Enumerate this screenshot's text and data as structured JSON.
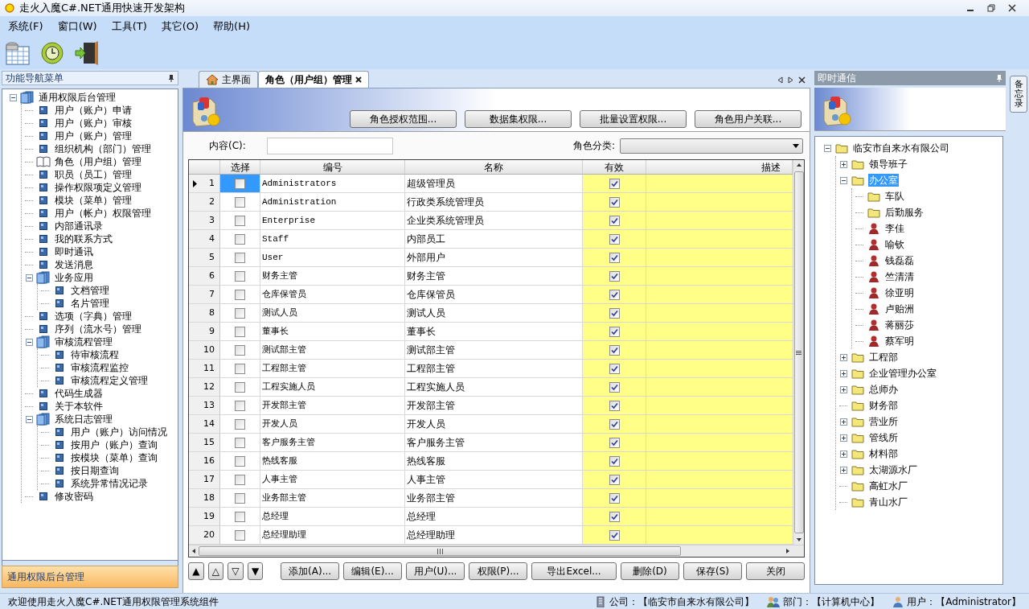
{
  "window": {
    "title": "走火入魔C#.NET通用快速开发架构"
  },
  "menu": [
    "系统(F)",
    "窗口(W)",
    "工具(T)",
    "其它(O)",
    "帮助(H)"
  ],
  "nav_panel": {
    "title": "功能导航菜单",
    "footer": "通用权限后台管理",
    "tree": [
      {
        "label": "通用权限后台管理",
        "kind": "group",
        "expanded": true,
        "children": [
          {
            "label": "用户（账户）申请",
            "kind": "item"
          },
          {
            "label": "用户（账户）审核",
            "kind": "item"
          },
          {
            "label": "用户（账户）管理",
            "kind": "item"
          },
          {
            "label": "组织机构（部门）管理",
            "kind": "item"
          },
          {
            "label": "角色（用户组）管理",
            "kind": "book"
          },
          {
            "label": "职员（员工）管理",
            "kind": "item"
          },
          {
            "label": "操作权限项定义管理",
            "kind": "item"
          },
          {
            "label": "模块（菜单）管理",
            "kind": "item"
          },
          {
            "label": "用户（帐户）权限管理",
            "kind": "item"
          },
          {
            "label": "内部通讯录",
            "kind": "item"
          },
          {
            "label": "我的联系方式",
            "kind": "item"
          },
          {
            "label": "即时通讯",
            "kind": "item"
          },
          {
            "label": "发送消息",
            "kind": "item"
          },
          {
            "label": "业务应用",
            "kind": "group",
            "expanded": true,
            "children": [
              {
                "label": "文档管理",
                "kind": "item"
              },
              {
                "label": "名片管理",
                "kind": "item"
              }
            ]
          },
          {
            "label": "选项（字典）管理",
            "kind": "item"
          },
          {
            "label": "序列（流水号）管理",
            "kind": "item"
          },
          {
            "label": "审核流程管理",
            "kind": "group",
            "expanded": true,
            "children": [
              {
                "label": "待审核流程",
                "kind": "item"
              },
              {
                "label": "审核流程监控",
                "kind": "item"
              },
              {
                "label": "审核流程定义管理",
                "kind": "item"
              }
            ]
          },
          {
            "label": "代码生成器",
            "kind": "item"
          },
          {
            "label": "关于本软件",
            "kind": "item"
          },
          {
            "label": "系统日志管理",
            "kind": "group",
            "expanded": true,
            "children": [
              {
                "label": "用户（账户）访问情况",
                "kind": "item"
              },
              {
                "label": "按用户（账户）查询",
                "kind": "item"
              },
              {
                "label": "按模块（菜单）查询",
                "kind": "item"
              },
              {
                "label": "按日期查询",
                "kind": "item"
              },
              {
                "label": "系统异常情况记录",
                "kind": "item"
              }
            ]
          },
          {
            "label": "修改密码",
            "kind": "item"
          }
        ]
      }
    ]
  },
  "tabs": [
    {
      "label": "主界面",
      "selected": false
    },
    {
      "label": "角色（用户组）管理",
      "selected": true
    }
  ],
  "actions": [
    "角色授权范围...",
    "数据集权限...",
    "批量设置权限...",
    "角色用户关联..."
  ],
  "filter": {
    "content_label": "内容(C):",
    "category_label": "角色分类:"
  },
  "table": {
    "columns": [
      "选择",
      "编号",
      "名称",
      "有效",
      "描述"
    ],
    "rows": [
      {
        "no": "1",
        "code": "Administrators",
        "name": "超级管理员",
        "chosen": false,
        "valid": true,
        "selected": true
      },
      {
        "no": "2",
        "code": "Administration",
        "name": "行政类系统管理员",
        "chosen": false,
        "valid": true,
        "selected": false
      },
      {
        "no": "3",
        "code": "Enterprise",
        "name": "企业类系统管理员",
        "chosen": false,
        "valid": true,
        "selected": false
      },
      {
        "no": "4",
        "code": "Staff",
        "name": "内部员工",
        "chosen": false,
        "valid": true,
        "selected": false
      },
      {
        "no": "5",
        "code": "User",
        "name": "外部用户",
        "chosen": false,
        "valid": true,
        "selected": false
      },
      {
        "no": "6",
        "code": "财务主管",
        "name": "财务主管",
        "chosen": false,
        "valid": true,
        "selected": false
      },
      {
        "no": "7",
        "code": "仓库保管员",
        "name": "仓库保管员",
        "chosen": false,
        "valid": true,
        "selected": false
      },
      {
        "no": "8",
        "code": "测试人员",
        "name": "测试人员",
        "chosen": false,
        "valid": true,
        "selected": false
      },
      {
        "no": "9",
        "code": "董事长",
        "name": "董事长",
        "chosen": false,
        "valid": true,
        "selected": false
      },
      {
        "no": "10",
        "code": "测试部主管",
        "name": "测试部主管",
        "chosen": false,
        "valid": true,
        "selected": false
      },
      {
        "no": "11",
        "code": "工程部主管",
        "name": "工程部主管",
        "chosen": false,
        "valid": true,
        "selected": false
      },
      {
        "no": "12",
        "code": "工程实施人员",
        "name": "工程实施人员",
        "chosen": false,
        "valid": true,
        "selected": false
      },
      {
        "no": "13",
        "code": "开发部主管",
        "name": "开发部主管",
        "chosen": false,
        "valid": true,
        "selected": false
      },
      {
        "no": "14",
        "code": "开发人员",
        "name": "开发人员",
        "chosen": false,
        "valid": true,
        "selected": false
      },
      {
        "no": "15",
        "code": "客户服务主管",
        "name": "客户服务主管",
        "chosen": false,
        "valid": true,
        "selected": false
      },
      {
        "no": "16",
        "code": "热线客服",
        "name": "热线客服",
        "chosen": false,
        "valid": true,
        "selected": false
      },
      {
        "no": "17",
        "code": "人事主管",
        "name": "人事主管",
        "chosen": false,
        "valid": true,
        "selected": false
      },
      {
        "no": "18",
        "code": "业务部主管",
        "name": "业务部主管",
        "chosen": false,
        "valid": true,
        "selected": false
      },
      {
        "no": "19",
        "code": "总经理",
        "name": "总经理",
        "chosen": false,
        "valid": true,
        "selected": false
      },
      {
        "no": "20",
        "code": "总经理助理",
        "name": "总经理助理",
        "chosen": false,
        "valid": true,
        "selected": false
      }
    ]
  },
  "move_buttons": [
    "▲",
    "△",
    "▽",
    "▼"
  ],
  "bottom_buttons": [
    "添加(A)...",
    "编辑(E)...",
    "用户(U)...",
    "权限(P)...",
    "导出Excel...",
    "删除(D)",
    "保存(S)",
    "关闭"
  ],
  "im_panel": {
    "title": "即时通信",
    "side_tab": "备忘录",
    "tree": [
      {
        "label": "临安市自来水有限公司",
        "kind": "folder",
        "expanded": true,
        "selected": false,
        "children": [
          {
            "label": "领导班子",
            "kind": "folder",
            "expanded": false,
            "selected": false
          },
          {
            "label": "办公室",
            "kind": "folder",
            "expanded": true,
            "selected": true,
            "children": [
              {
                "label": "车队",
                "kind": "folder",
                "selected": false
              },
              {
                "label": "后勤服务",
                "kind": "folder",
                "selected": false
              },
              {
                "label": "李佳",
                "kind": "person",
                "selected": false
              },
              {
                "label": "喻钦",
                "kind": "person",
                "selected": false
              },
              {
                "label": "钱磊磊",
                "kind": "person",
                "selected": false
              },
              {
                "label": "竺清清",
                "kind": "person",
                "selected": false
              },
              {
                "label": "徐亚明",
                "kind": "person",
                "selected": false
              },
              {
                "label": "卢贻洲",
                "kind": "person",
                "selected": false
              },
              {
                "label": "蒋丽莎",
                "kind": "person",
                "selected": false
              },
              {
                "label": "蔡军明",
                "kind": "person",
                "selected": false
              }
            ]
          },
          {
            "label": "工程部",
            "kind": "folder",
            "expanded": false,
            "selected": false
          },
          {
            "label": "企业管理办公室",
            "kind": "folder",
            "expanded": false,
            "selected": false
          },
          {
            "label": "总师办",
            "kind": "folder",
            "expanded": false,
            "selected": false
          },
          {
            "label": "财务部",
            "kind": "folder",
            "selected": false
          },
          {
            "label": "营业所",
            "kind": "folder",
            "expanded": false,
            "selected": false
          },
          {
            "label": "管线所",
            "kind": "folder",
            "expanded": false,
            "selected": false
          },
          {
            "label": "材料部",
            "kind": "folder",
            "expanded": false,
            "selected": false
          },
          {
            "label": "太湖源水厂",
            "kind": "folder",
            "expanded": false,
            "selected": false
          },
          {
            "label": "高虹水厂",
            "kind": "folder",
            "selected": false
          },
          {
            "label": "青山水厂",
            "kind": "folder",
            "selected": false
          }
        ]
      }
    ]
  },
  "status_bar": {
    "message": "欢迎使用走火入魔C#.NET通用权限管理系统组件",
    "company": "公司：【临安市自来水有限公司】",
    "department": "部门：【计算机中心】",
    "user": "用户：【Administrator】"
  }
}
